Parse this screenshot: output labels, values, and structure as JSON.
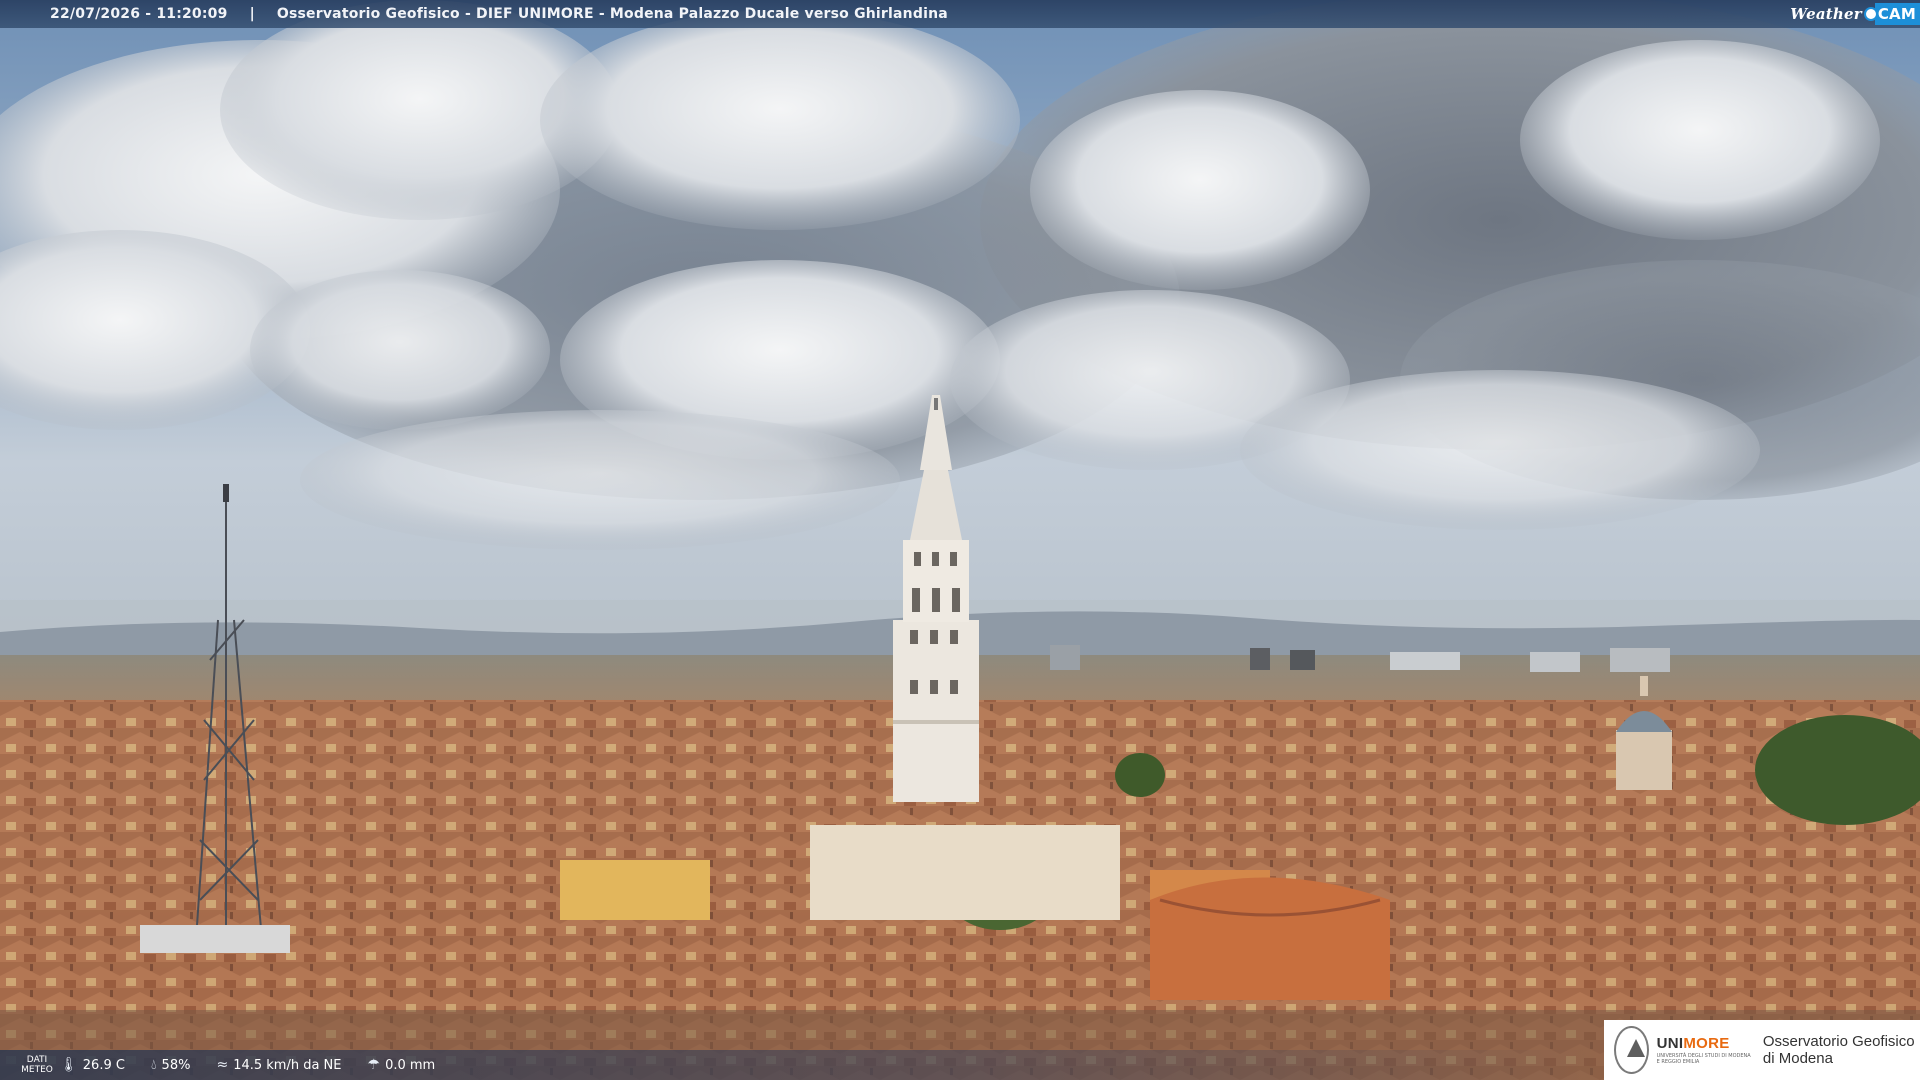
{
  "caption": {
    "timestamp": "22/07/2026 - 11:20:09",
    "separator": "|",
    "title": "Osservatorio Geofisico - DIEF UNIMORE - Modena Palazzo Ducale verso Ghirlandina"
  },
  "brand_logo": {
    "weather": "Weather",
    "cam": "CAM"
  },
  "meteo": {
    "label": "DATI METEO",
    "temperature": "26.9 C",
    "humidity": "58%",
    "wind": "14.5 km/h da NE",
    "rain": "0.0 mm"
  },
  "institution": {
    "uni": "UNI",
    "more": "MORE",
    "subtitle": "UNIVERSITÀ DEGLI STUDI DI MODENA E REGGIO EMILIA",
    "observatory": "Osservatorio Geofisico di Modena"
  },
  "icons": [
    "thermometer-icon",
    "humidity-icon",
    "wind-icon",
    "rain-icon",
    "unimore-seal-icon"
  ]
}
